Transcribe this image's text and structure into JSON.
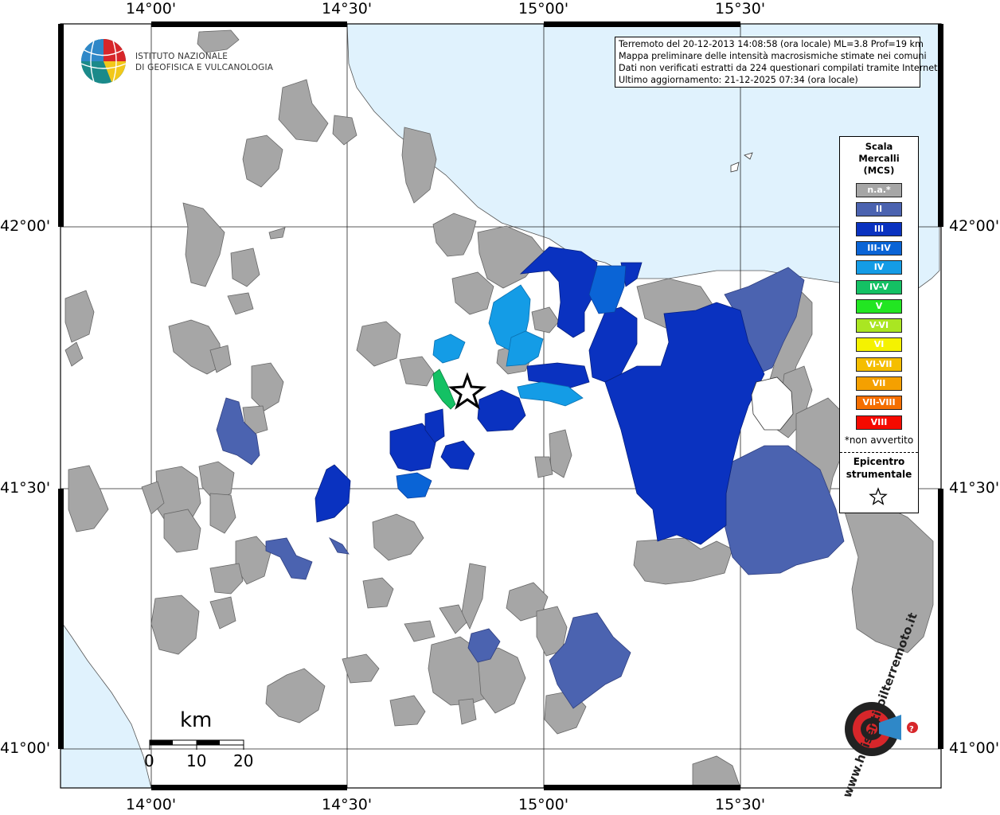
{
  "info": {
    "line1": "Terremoto del 20-12-2013 14:08:58 (ora locale) ML=3.8 Prof=19 km",
    "line2": "Mappa preliminare delle intensità macrosismiche stimate nei comuni",
    "line3": "Dati non verificati estratti da 224 questionari compilati tramite Internet.",
    "line4": "Ultimo aggiornamento: 21-12-2025 07:34 (ora locale)"
  },
  "logo": {
    "line1": "ISTITUTO NAZIONALE",
    "line2": "DI GEOFISICA E VULCANOLOGIA"
  },
  "axes": {
    "lon_top": [
      "14°00'",
      "14°30'",
      "15°00'",
      "15°30'"
    ],
    "lon_bottom": [
      "14°00'",
      "14°30'",
      "15°00'",
      "15°30'"
    ],
    "lat_left": [
      "42°00'",
      "41°30'",
      "41°00'"
    ],
    "lat_right": [
      "42°00'",
      "41°30'",
      "41°00'"
    ]
  },
  "legend": {
    "title1": "Scala",
    "title2": "Mercalli",
    "title3": "(MCS)",
    "items": [
      {
        "label": "n.a.*",
        "color": "#a6a6a6"
      },
      {
        "label": "II",
        "color": "#4b63b0"
      },
      {
        "label": "III",
        "color": "#0a32c0"
      },
      {
        "label": "III-IV",
        "color": "#0a64d6"
      },
      {
        "label": "IV",
        "color": "#149ce6"
      },
      {
        "label": "IV-V",
        "color": "#14c164"
      },
      {
        "label": "V",
        "color": "#22e622"
      },
      {
        "label": "V-VI",
        "color": "#aae622"
      },
      {
        "label": "VI",
        "color": "#f5f200"
      },
      {
        "label": "VI-VII",
        "color": "#f5be00"
      },
      {
        "label": "VII",
        "color": "#f5a000"
      },
      {
        "label": "VII-VIII",
        "color": "#f56e00"
      },
      {
        "label": "VIII",
        "color": "#f50a00"
      }
    ],
    "note": "*non avvertito",
    "epicenter1": "Epicentro",
    "epicenter2": "strumentale"
  },
  "scale": {
    "unit": "km",
    "ticks": [
      "0",
      "10",
      "20"
    ]
  },
  "watermark": {
    "text": "www.haisentitoilterremoto.it"
  },
  "colors": {
    "sea": "#e0f2fd",
    "land": "#ffffff",
    "na": "#a6a6a6"
  }
}
